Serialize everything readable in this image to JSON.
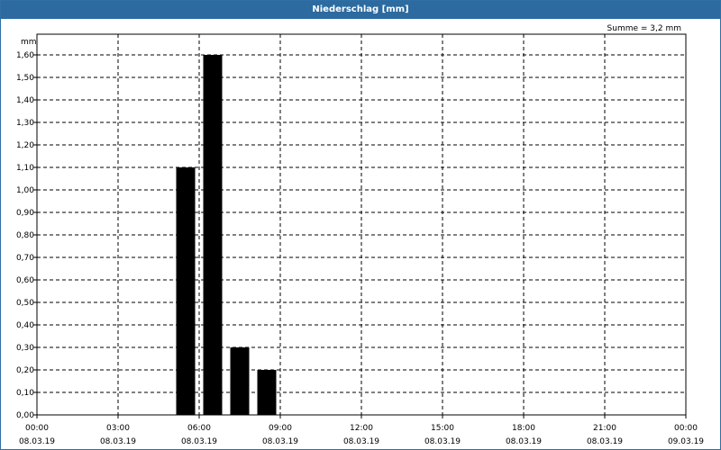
{
  "window": {
    "title": "Niederschlag [mm]"
  },
  "summary": "Summe = 3,2 mm",
  "chart_data": {
    "type": "bar",
    "title": "Niederschlag [mm]",
    "ylabel": "mm",
    "ylim": [
      0,
      1.6
    ],
    "y_ticks": [
      "0,00",
      "0,10",
      "0,20",
      "0,30",
      "0,40",
      "0,50",
      "0,60",
      "0,70",
      "0,80",
      "0,90",
      "1,00",
      "1,10",
      "1,20",
      "1,30",
      "1,40",
      "1,50",
      "1,60"
    ],
    "x_ticks": [
      {
        "time": "00:00",
        "date": "08.03.19"
      },
      {
        "time": "03:00",
        "date": "08.03.19"
      },
      {
        "time": "06:00",
        "date": "08.03.19"
      },
      {
        "time": "09:00",
        "date": "08.03.19"
      },
      {
        "time": "12:00",
        "date": "08.03.19"
      },
      {
        "time": "15:00",
        "date": "08.03.19"
      },
      {
        "time": "18:00",
        "date": "08.03.19"
      },
      {
        "time": "21:00",
        "date": "08.03.19"
      },
      {
        "time": "00:00",
        "date": "09.03.19"
      }
    ],
    "bars": [
      {
        "x": "08.03.19 05:30",
        "value": 1.1
      },
      {
        "x": "08.03.19 06:30",
        "value": 1.6
      },
      {
        "x": "08.03.19 07:30",
        "value": 0.3
      },
      {
        "x": "08.03.19 08:30",
        "value": 0.2
      }
    ],
    "grid": true,
    "bar_color": "#000000"
  }
}
